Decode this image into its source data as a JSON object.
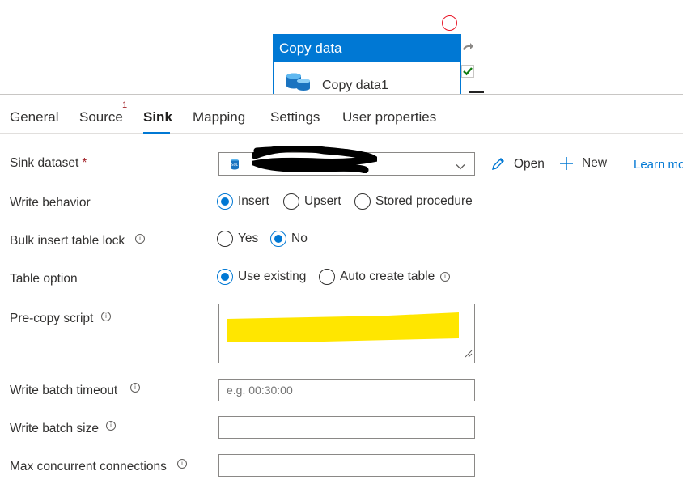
{
  "canvas": {
    "activity_title": "Copy data",
    "activity_name": "Copy data1"
  },
  "tabs": [
    {
      "label": "General"
    },
    {
      "label": "Source",
      "badge": "1"
    },
    {
      "label": "Sink",
      "active": true
    },
    {
      "label": "Mapping"
    },
    {
      "label": "Settings"
    },
    {
      "label": "User properties"
    }
  ],
  "form": {
    "sink_dataset": {
      "label": "Sink dataset",
      "required_mark": "*",
      "value_visible": "",
      "open_label": "Open",
      "new_label": "New",
      "learn_label": "Learn mo"
    },
    "write_behavior": {
      "label": "Write behavior",
      "options": [
        "Insert",
        "Upsert",
        "Stored procedure"
      ],
      "selected": "Insert"
    },
    "bulk_insert": {
      "label": "Bulk insert table lock",
      "options": [
        "Yes",
        "No"
      ],
      "selected": "No"
    },
    "table_option": {
      "label": "Table option",
      "options": [
        "Use existing",
        "Auto create table"
      ],
      "selected": "Use existing"
    },
    "pre_copy_script": {
      "label": "Pre-copy script"
    },
    "write_batch_timeout": {
      "label": "Write batch timeout",
      "placeholder": "e.g. 00:30:00"
    },
    "write_batch_size": {
      "label": "Write batch size"
    },
    "max_concurrent": {
      "label": "Max concurrent connections"
    }
  },
  "colors": {
    "accent": "#0078d4",
    "required": "#a4262c",
    "redact_yellow": "#ffe600",
    "redact_black": "#000000"
  },
  "icons": [
    "sql-database-icon",
    "pencil-icon",
    "plus-icon",
    "info-icon",
    "chevron-down-icon",
    "redo-icon",
    "check-icon",
    "resize-grip-icon"
  ]
}
